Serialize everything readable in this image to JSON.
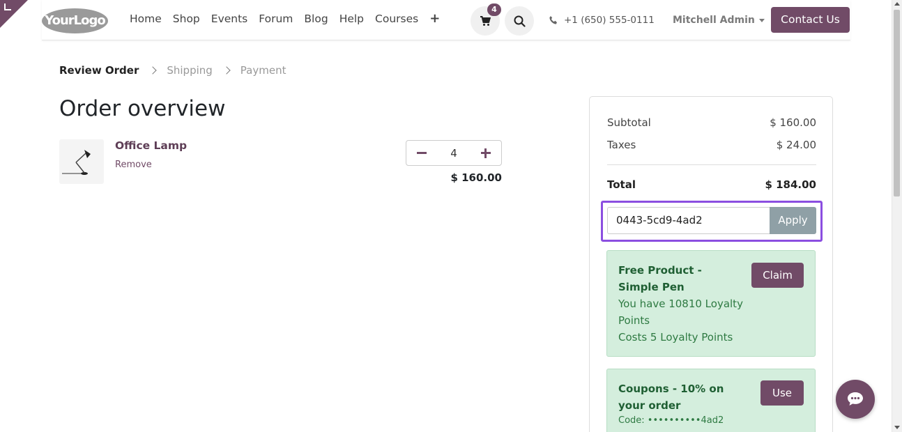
{
  "header": {
    "logo": "YourLogo",
    "nav": [
      "Home",
      "Shop",
      "Events",
      "Forum",
      "Blog",
      "Help",
      "Courses"
    ],
    "cart_count": "4",
    "phone": "+1 (650) 555-0111",
    "user": "Mitchell Admin",
    "contact_label": "Contact Us"
  },
  "breadcrumb": {
    "step1": "Review Order",
    "step2": "Shipping",
    "step3": "Payment"
  },
  "page_title": "Order overview",
  "product": {
    "name": "Office Lamp",
    "remove_label": "Remove",
    "quantity": "4",
    "line_total": "$ 160.00"
  },
  "summary": {
    "subtotal_label": "Subtotal",
    "subtotal": "$ 160.00",
    "taxes_label": "Taxes",
    "taxes": "$ 24.00",
    "total_label": "Total",
    "total": "$ 184.00",
    "promo_value": "0443-5cd9-4ad2",
    "apply_label": "Apply"
  },
  "rewards": [
    {
      "title": "Free Product - Simple Pen",
      "line1": "You have 10810 Loyalty Points",
      "line2": "Costs 5 Loyalty Points",
      "button": "Claim"
    },
    {
      "title": "Coupons - 10% on your order",
      "code": "Code: ••••••••••4ad2",
      "button": "Use"
    }
  ],
  "colors": {
    "brand": "#714B67",
    "success_bg": "#d4eedd",
    "focus": "#8b4ee0"
  }
}
